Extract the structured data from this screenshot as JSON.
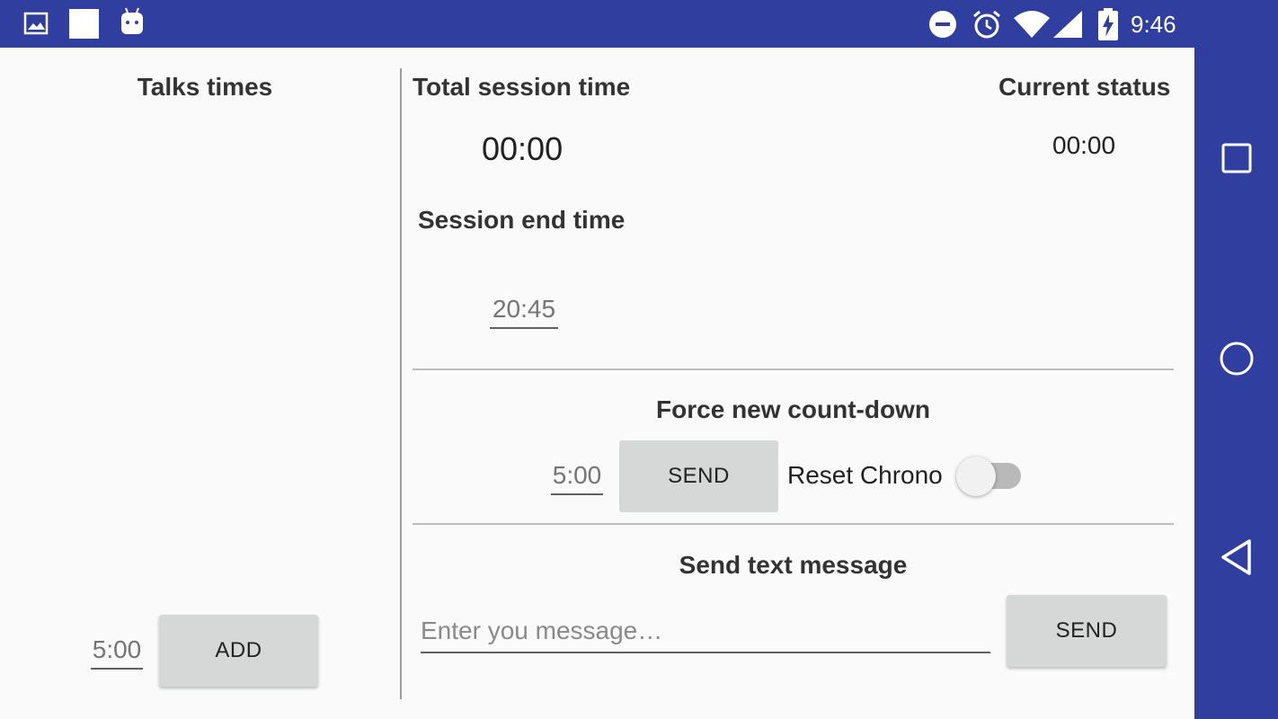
{
  "status_bar": {
    "time": "9:46",
    "icons": [
      "image-icon",
      "square-icon",
      "android-icon",
      "dnd-icon",
      "alarm-icon",
      "wifi-icon",
      "signal-icon",
      "battery-charging-icon"
    ]
  },
  "left_panel": {
    "title": "Talks times",
    "talk_duration_value": "5:00",
    "add_button_label": "ADD"
  },
  "session": {
    "total_title": "Total session time",
    "total_value": "00:00",
    "current_status_title": "Current status",
    "current_status_value": "00:00",
    "end_time_title": "Session end time",
    "end_time_value": "20:45"
  },
  "countdown": {
    "title": "Force new count-down",
    "value": "5:00",
    "send_label": "SEND",
    "reset_label": "Reset Chrono",
    "reset_checked": false
  },
  "message": {
    "title": "Send text message",
    "placeholder": "Enter you message…",
    "send_label": "SEND"
  },
  "nav_bar": {
    "buttons": [
      "recents-icon",
      "home-icon",
      "back-icon"
    ]
  },
  "colors": {
    "system_bar": "#303f9f",
    "button_bg": "#d6d7d7",
    "background": "#fafafa"
  }
}
